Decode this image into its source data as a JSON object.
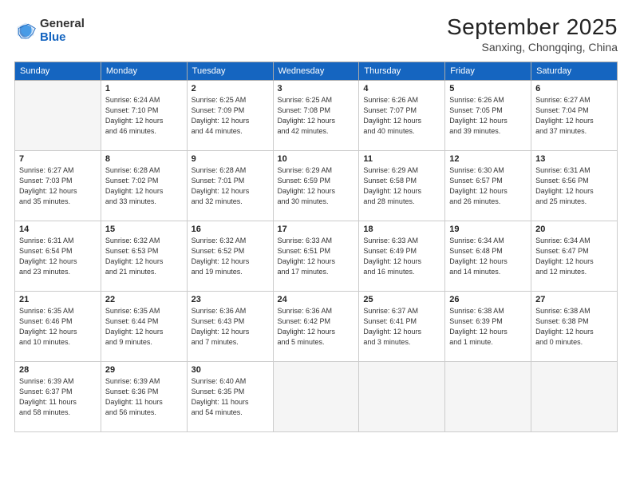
{
  "header": {
    "logo": {
      "general": "General",
      "blue": "Blue"
    },
    "title": "September 2025",
    "location": "Sanxing, Chongqing, China"
  },
  "weekdays": [
    "Sunday",
    "Monday",
    "Tuesday",
    "Wednesday",
    "Thursday",
    "Friday",
    "Saturday"
  ],
  "weeks": [
    [
      {
        "day": "",
        "empty": true
      },
      {
        "day": "1",
        "sunrise": "6:24 AM",
        "sunset": "7:10 PM",
        "daylight": "12 hours and 46 minutes."
      },
      {
        "day": "2",
        "sunrise": "6:25 AM",
        "sunset": "7:09 PM",
        "daylight": "12 hours and 44 minutes."
      },
      {
        "day": "3",
        "sunrise": "6:25 AM",
        "sunset": "7:08 PM",
        "daylight": "12 hours and 42 minutes."
      },
      {
        "day": "4",
        "sunrise": "6:26 AM",
        "sunset": "7:07 PM",
        "daylight": "12 hours and 40 minutes."
      },
      {
        "day": "5",
        "sunrise": "6:26 AM",
        "sunset": "7:05 PM",
        "daylight": "12 hours and 39 minutes."
      },
      {
        "day": "6",
        "sunrise": "6:27 AM",
        "sunset": "7:04 PM",
        "daylight": "12 hours and 37 minutes."
      }
    ],
    [
      {
        "day": "7",
        "sunrise": "6:27 AM",
        "sunset": "7:03 PM",
        "daylight": "12 hours and 35 minutes."
      },
      {
        "day": "8",
        "sunrise": "6:28 AM",
        "sunset": "7:02 PM",
        "daylight": "12 hours and 33 minutes."
      },
      {
        "day": "9",
        "sunrise": "6:28 AM",
        "sunset": "7:01 PM",
        "daylight": "12 hours and 32 minutes."
      },
      {
        "day": "10",
        "sunrise": "6:29 AM",
        "sunset": "6:59 PM",
        "daylight": "12 hours and 30 minutes."
      },
      {
        "day": "11",
        "sunrise": "6:29 AM",
        "sunset": "6:58 PM",
        "daylight": "12 hours and 28 minutes."
      },
      {
        "day": "12",
        "sunrise": "6:30 AM",
        "sunset": "6:57 PM",
        "daylight": "12 hours and 26 minutes."
      },
      {
        "day": "13",
        "sunrise": "6:31 AM",
        "sunset": "6:56 PM",
        "daylight": "12 hours and 25 minutes."
      }
    ],
    [
      {
        "day": "14",
        "sunrise": "6:31 AM",
        "sunset": "6:54 PM",
        "daylight": "12 hours and 23 minutes."
      },
      {
        "day": "15",
        "sunrise": "6:32 AM",
        "sunset": "6:53 PM",
        "daylight": "12 hours and 21 minutes."
      },
      {
        "day": "16",
        "sunrise": "6:32 AM",
        "sunset": "6:52 PM",
        "daylight": "12 hours and 19 minutes."
      },
      {
        "day": "17",
        "sunrise": "6:33 AM",
        "sunset": "6:51 PM",
        "daylight": "12 hours and 17 minutes."
      },
      {
        "day": "18",
        "sunrise": "6:33 AM",
        "sunset": "6:49 PM",
        "daylight": "12 hours and 16 minutes."
      },
      {
        "day": "19",
        "sunrise": "6:34 AM",
        "sunset": "6:48 PM",
        "daylight": "12 hours and 14 minutes."
      },
      {
        "day": "20",
        "sunrise": "6:34 AM",
        "sunset": "6:47 PM",
        "daylight": "12 hours and 12 minutes."
      }
    ],
    [
      {
        "day": "21",
        "sunrise": "6:35 AM",
        "sunset": "6:46 PM",
        "daylight": "12 hours and 10 minutes."
      },
      {
        "day": "22",
        "sunrise": "6:35 AM",
        "sunset": "6:44 PM",
        "daylight": "12 hours and 9 minutes."
      },
      {
        "day": "23",
        "sunrise": "6:36 AM",
        "sunset": "6:43 PM",
        "daylight": "12 hours and 7 minutes."
      },
      {
        "day": "24",
        "sunrise": "6:36 AM",
        "sunset": "6:42 PM",
        "daylight": "12 hours and 5 minutes."
      },
      {
        "day": "25",
        "sunrise": "6:37 AM",
        "sunset": "6:41 PM",
        "daylight": "12 hours and 3 minutes."
      },
      {
        "day": "26",
        "sunrise": "6:38 AM",
        "sunset": "6:39 PM",
        "daylight": "12 hours and 1 minute."
      },
      {
        "day": "27",
        "sunrise": "6:38 AM",
        "sunset": "6:38 PM",
        "daylight": "12 hours and 0 minutes."
      }
    ],
    [
      {
        "day": "28",
        "sunrise": "6:39 AM",
        "sunset": "6:37 PM",
        "daylight": "11 hours and 58 minutes."
      },
      {
        "day": "29",
        "sunrise": "6:39 AM",
        "sunset": "6:36 PM",
        "daylight": "11 hours and 56 minutes."
      },
      {
        "day": "30",
        "sunrise": "6:40 AM",
        "sunset": "6:35 PM",
        "daylight": "11 hours and 54 minutes."
      },
      {
        "day": "",
        "empty": true
      },
      {
        "day": "",
        "empty": true
      },
      {
        "day": "",
        "empty": true
      },
      {
        "day": "",
        "empty": true
      }
    ]
  ],
  "labels": {
    "sunrise": "Sunrise:",
    "sunset": "Sunset:",
    "daylight": "Daylight:"
  }
}
